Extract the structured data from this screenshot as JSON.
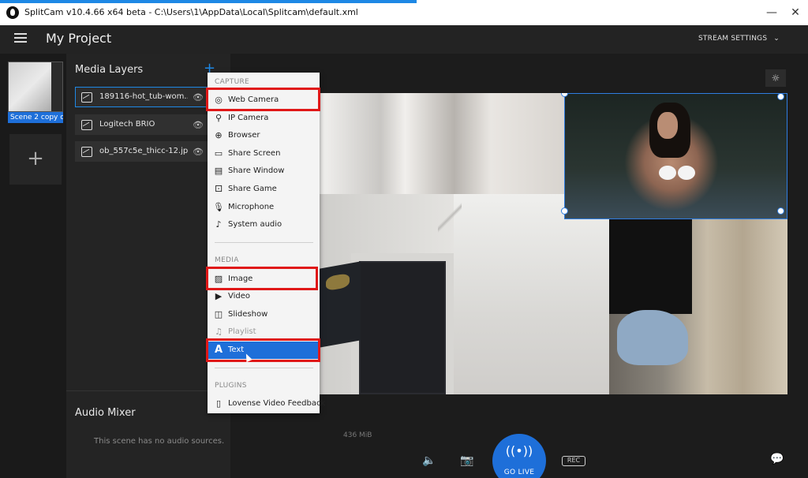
{
  "window": {
    "title": "SplitCam v10.4.66 x64 beta - C:\\Users\\1\\AppData\\Local\\Splitcam\\default.xml",
    "minimize_glyph": "—",
    "close_glyph": "✕"
  },
  "header": {
    "project_title": "My Project",
    "stream_settings_label": "STREAM SETTINGS",
    "stream_settings_chevron": "⌄"
  },
  "scenes": {
    "active_scene_label": "Scene 2 copy c",
    "add_glyph": "+"
  },
  "media_layers": {
    "title": "Media Layers",
    "add_glyph": "+",
    "items": [
      {
        "name": "189116-hot_tub-wom...",
        "icon": "image-icon",
        "selected": true
      },
      {
        "name": "Logitech BRIO",
        "icon": "image-icon",
        "selected": false
      },
      {
        "name": "ob_557c5e_thicc-12.jpg",
        "icon": "image-icon",
        "selected": false
      }
    ],
    "eye_glyph": "👁"
  },
  "audio_mixer": {
    "title": "Audio Mixer",
    "empty_text": "This scene has no audio sources."
  },
  "canvas": {
    "size_text": "436 MiB"
  },
  "add_menu": {
    "capture_title": "CAPTURE",
    "capture_items": [
      {
        "label": "Web Camera",
        "icon": "webcam-icon",
        "glyph": "◎"
      },
      {
        "label": "IP Camera",
        "icon": "ip-camera-icon",
        "glyph": "⚲"
      },
      {
        "label": "Browser",
        "icon": "globe-icon",
        "glyph": "⊕"
      },
      {
        "label": "Share Screen",
        "icon": "screen-icon",
        "glyph": "▭"
      },
      {
        "label": "Share Window",
        "icon": "window-icon",
        "glyph": "▤"
      },
      {
        "label": "Share Game",
        "icon": "gamepad-icon",
        "glyph": "⚀"
      },
      {
        "label": "Microphone",
        "icon": "microphone-icon",
        "glyph": "🎙"
      },
      {
        "label": "System audio",
        "icon": "speaker-icon",
        "glyph": "♪"
      }
    ],
    "media_title": "MEDIA",
    "media_items": [
      {
        "label": "Image",
        "icon": "image-icon",
        "glyph": "▨"
      },
      {
        "label": "Video",
        "icon": "video-icon",
        "glyph": "▶"
      },
      {
        "label": "Slideshow",
        "icon": "slideshow-icon",
        "glyph": "◫"
      },
      {
        "label": "Playlist",
        "icon": "playlist-icon",
        "glyph": "♫"
      },
      {
        "label": "Text",
        "icon": "text-icon",
        "glyph": "A"
      }
    ],
    "plugins_title": "PLUGINS",
    "plugin_items": [
      {
        "label": "Lovense Video Feedback",
        "icon": "plugin-icon",
        "glyph": "▯"
      }
    ]
  },
  "bottom_bar": {
    "go_live_label": "GO LIVE",
    "go_live_glyph": "((•))",
    "speaker_glyph": "🔈",
    "camera_glyph": "📷",
    "rec_glyph": "REC",
    "chat_glyph": "💬",
    "sun_glyph": "☼"
  },
  "colors": {
    "accent": "#1e6fd9",
    "highlight_box": "#e01818"
  }
}
